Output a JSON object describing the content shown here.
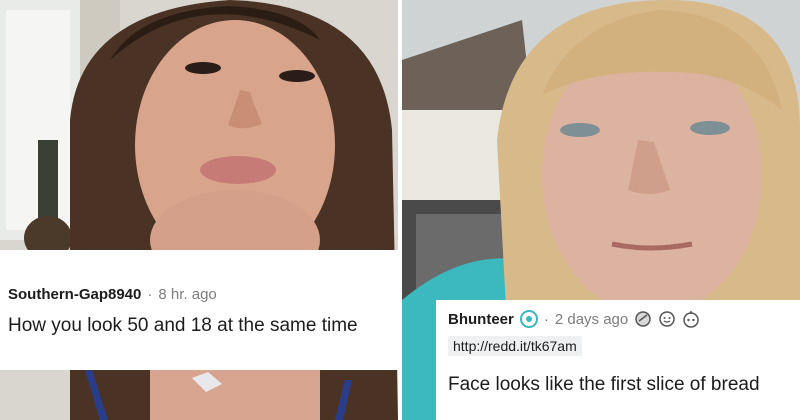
{
  "left_post": {
    "username": "Southern-Gap8940",
    "separator": "·",
    "timestamp": "8 hr. ago",
    "comment": "How you look 50 and 18 at the same time"
  },
  "right_post": {
    "username": "Bhunteer",
    "separator": "·",
    "timestamp": "2 days ago",
    "link": "http://redd.it/tk67am",
    "comment": "Face looks like the first slice of bread",
    "award_icons": [
      "avatar-badge-icon",
      "helpful-award-icon",
      "wholesome-award-icon",
      "bravo-award-icon"
    ]
  },
  "colors": {
    "username": "#1c1c1c",
    "meta_gray": "#7c7c7c",
    "card_bg": "#ffffff",
    "link_bg": "#eef0f2",
    "jacket_teal": "#3cb8bf"
  }
}
